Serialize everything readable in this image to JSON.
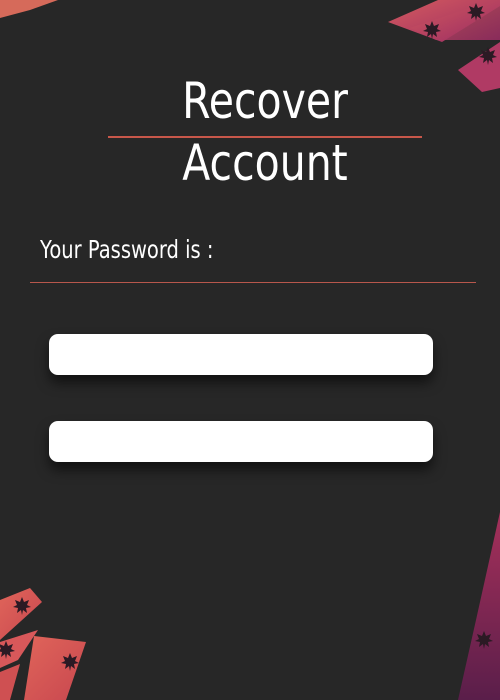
{
  "page": {
    "title": "Recover Account",
    "password_label": "Your Password is :"
  },
  "fields": [
    {
      "value": "",
      "placeholder": ""
    },
    {
      "value": "",
      "placeholder": ""
    }
  ],
  "colors": {
    "background": "#272727",
    "accent_line": "#c8574a",
    "field_background": "#ffffff",
    "text": "#ffffff",
    "decoration_coral": "#d9595a",
    "decoration_magenta": "#9c2a5a"
  },
  "decorations": [
    "maple-leaf-icon"
  ]
}
